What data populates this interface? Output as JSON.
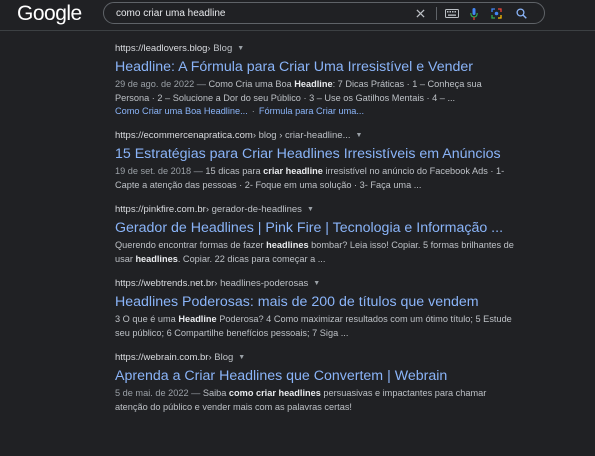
{
  "header": {
    "logo": "Google",
    "search": {
      "value": "como criar uma headline",
      "placeholder": ""
    }
  },
  "results": [
    {
      "domain": "https://leadlovers.blog",
      "path": " › Blog",
      "title": "Headline: A Fórmula para Criar Uma Irresistível e Vender",
      "snippet": [
        {
          "t": "29 de ago. de 2022 — ",
          "s": "date"
        },
        {
          "t": "Como Cria uma Boa "
        },
        {
          "t": "Headline",
          "s": "b"
        },
        {
          "t": ": 7 Dicas Práticas · 1 – Conheça sua Persona · 2 – Solucione a Dor do seu Público · 3 – Use os Gatilhos Mentais · 4 – ..."
        }
      ],
      "sitelinks": [
        "Como Criar uma Boa Headline...",
        "Fórmula para Criar uma..."
      ]
    },
    {
      "domain": "https://ecommercenapratica.com",
      "path": " › blog › criar-headline...",
      "title": "15 Estratégias para Criar Headlines Irresistíveis em Anúncios",
      "snippet": [
        {
          "t": "19 de set. de 2018 — ",
          "s": "date"
        },
        {
          "t": "15 dicas para "
        },
        {
          "t": "criar headline",
          "s": "b"
        },
        {
          "t": " irresistível no anúncio do Facebook Ads · 1- Capte a atenção das pessoas · 2- Foque em uma solução · 3- Faça uma ..."
        }
      ]
    },
    {
      "domain": "https://pinkfire.com.br",
      "path": " › gerador-de-headlines",
      "title": "Gerador de Headlines | Pink Fire | Tecnologia e Informação ...",
      "snippet": [
        {
          "t": "Querendo encontrar formas de fazer "
        },
        {
          "t": "headlines",
          "s": "b"
        },
        {
          "t": " bombar? Leia isso! Copiar. 5 formas brilhantes de usar "
        },
        {
          "t": "headlines",
          "s": "b"
        },
        {
          "t": ". Copiar. 22 dicas para começar a ..."
        }
      ]
    },
    {
      "domain": "https://webtrends.net.br",
      "path": " › headlines-poderosas",
      "title": "Headlines Poderosas: mais de 200 de títulos que vendem",
      "snippet": [
        {
          "t": "3 O que é uma "
        },
        {
          "t": "Headline",
          "s": "b"
        },
        {
          "t": " Poderosa? 4 Como maximizar resultados com um ótimo título; 5 Estude seu público; 6 Compartilhe benefícios pessoais; 7 Siga ..."
        }
      ]
    },
    {
      "domain": "https://webrain.com.br",
      "path": " › Blog",
      "title": "Aprenda a Criar Headlines que Convertem | Webrain",
      "snippet": [
        {
          "t": "5 de mai. de 2022 — ",
          "s": "date"
        },
        {
          "t": "Saiba "
        },
        {
          "t": "como criar headlines",
          "s": "b"
        },
        {
          "t": " persuasivas e impactantes para chamar atenção do público e vender mais com as palavras certas!"
        }
      ]
    }
  ],
  "icons": {
    "clear": "close-icon",
    "keyboard": "keyboard-icon",
    "voice": "microphone-icon",
    "lens": "camera-icon",
    "search": "search-icon",
    "result_menu": "more-vert-icon"
  },
  "colors": {
    "background": "#202124",
    "link": "#8ab4f8",
    "text": "#bdc1c6",
    "border": "#5f6368"
  }
}
